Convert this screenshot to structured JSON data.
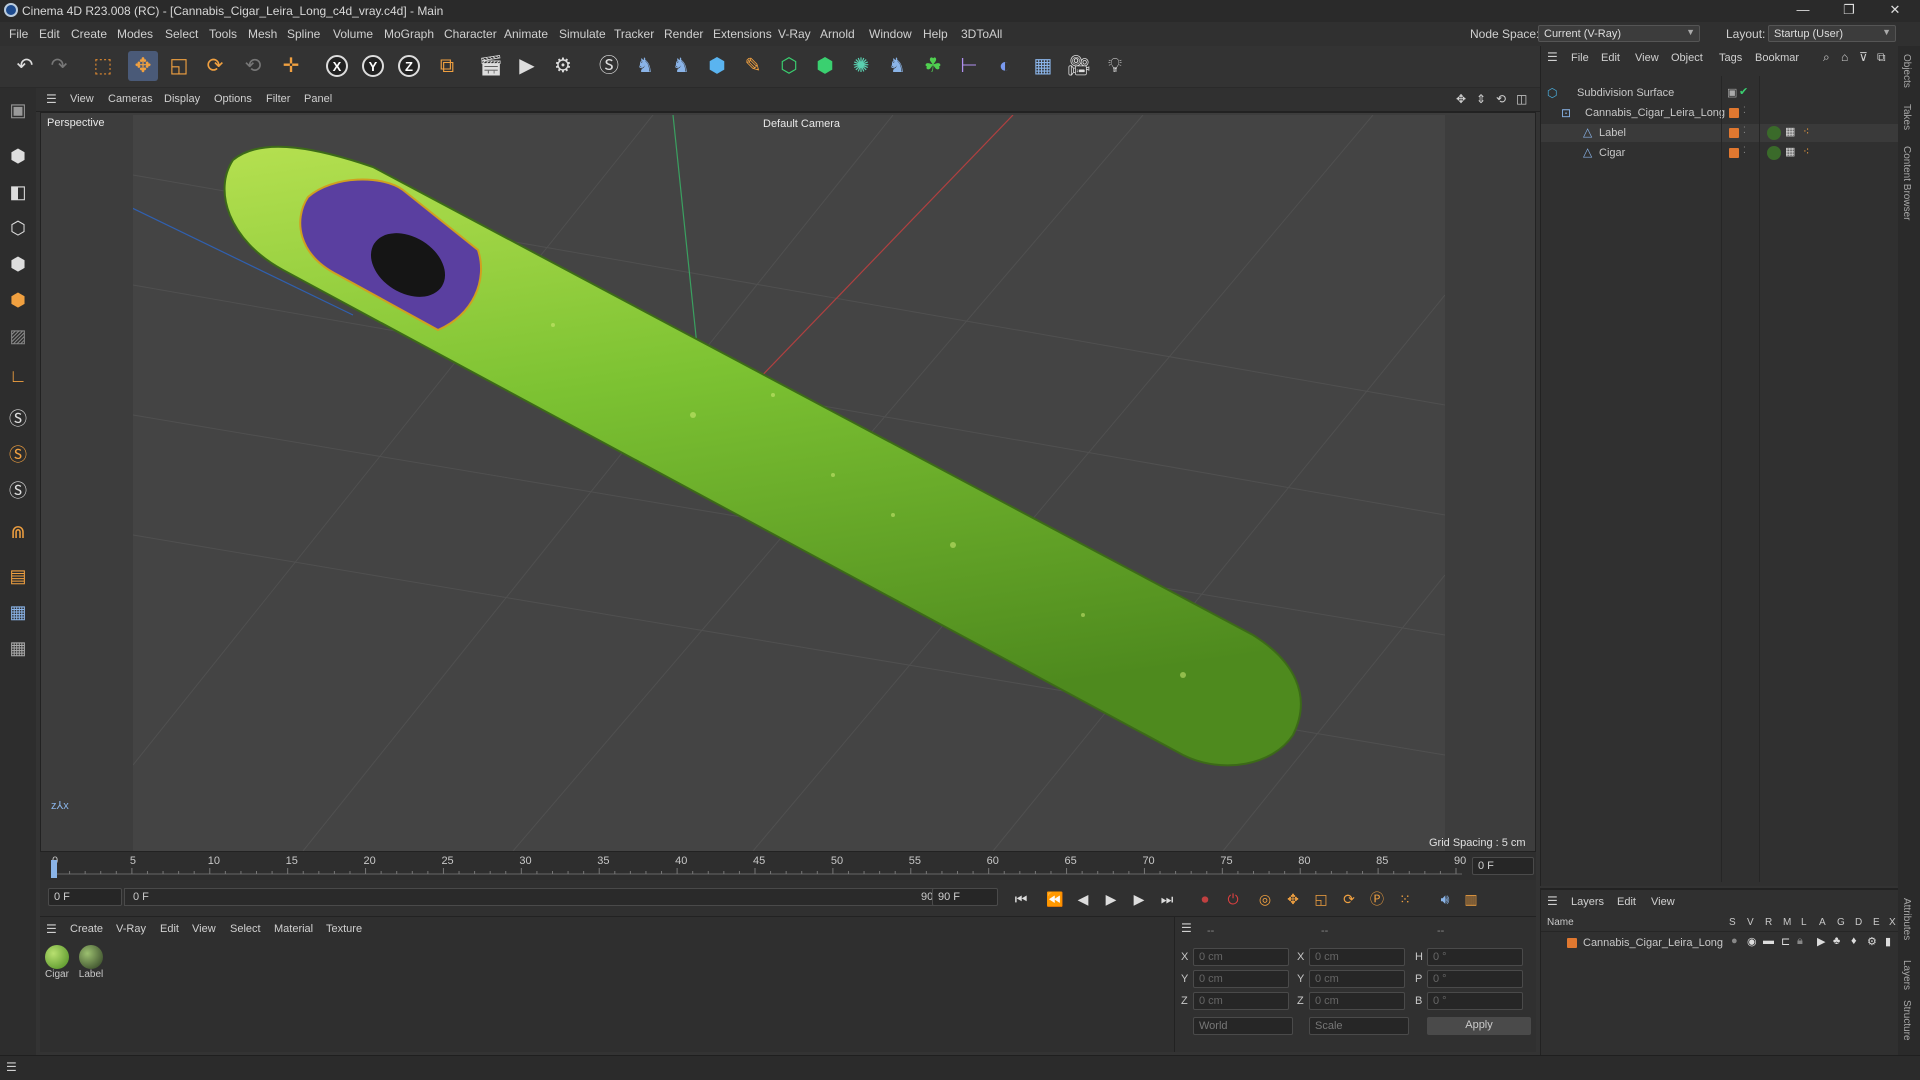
{
  "window": {
    "title": "Cinema 4D R23.008 (RC) - [Cannabis_Cigar_Leira_Long_c4d_vray.c4d] - Main",
    "minimize": "—",
    "restore": "❐",
    "close": "✕"
  },
  "menu": {
    "items": [
      "File",
      "Edit",
      "Create",
      "Modes",
      "Select",
      "Tools",
      "Mesh",
      "Spline",
      "Volume",
      "MoGraph",
      "Character",
      "Animate",
      "Simulate",
      "Tracker",
      "Render",
      "Extensions",
      "V-Ray",
      "Arnold",
      "Window",
      "Help",
      "3DToAll"
    ],
    "node_space_label": "Node Space:",
    "node_space_value": "Current (V-Ray)",
    "layout_label": "Layout:",
    "layout_value": "Startup (User)"
  },
  "viewport": {
    "menu": [
      "View",
      "Cameras",
      "Display",
      "Options",
      "Filter",
      "Panel"
    ],
    "view_name": "Perspective",
    "camera": "Default Camera",
    "grid_spacing": "Grid Spacing : 5 cm"
  },
  "timeline": {
    "ticks": [
      "0",
      "5",
      "10",
      "15",
      "20",
      "25",
      "30",
      "35",
      "40",
      "45",
      "50",
      "55",
      "60",
      "65",
      "70",
      "75",
      "80",
      "85",
      "90"
    ],
    "current_frame_field": "0 F",
    "start_field": "0 F",
    "range_start": "0 F",
    "range_end": "90 F",
    "end_field": "90 F"
  },
  "material_manager": {
    "menu": [
      "Create",
      "V-Ray",
      "Edit",
      "View",
      "Select",
      "Material",
      "Texture"
    ],
    "materials": [
      "Cigar",
      "Label"
    ]
  },
  "coordinates": {
    "header": [
      "--",
      "--",
      "--"
    ],
    "rows": [
      {
        "a": "X",
        "av": "0 cm",
        "b": "X",
        "bv": "0 cm",
        "c": "H",
        "cv": "0 °"
      },
      {
        "a": "Y",
        "av": "0 cm",
        "b": "Y",
        "bv": "0 cm",
        "c": "P",
        "cv": "0 °"
      },
      {
        "a": "Z",
        "av": "0 cm",
        "b": "Z",
        "bv": "0 cm",
        "c": "B",
        "cv": "0 °"
      }
    ],
    "mode1": "World",
    "mode2": "Scale",
    "apply": "Apply"
  },
  "object_manager": {
    "menu": [
      "File",
      "Edit",
      "View",
      "Object",
      "Tags",
      "Bookmar"
    ],
    "objects": [
      {
        "name": "Subdivision Surface",
        "level": 0
      },
      {
        "name": "Cannabis_Cigar_Leira_Long",
        "level": 1
      },
      {
        "name": "Label",
        "level": 2
      },
      {
        "name": "Cigar",
        "level": 2
      }
    ]
  },
  "layer_manager": {
    "menu": [
      "Layers",
      "Edit",
      "View"
    ],
    "col_name": "Name",
    "col_flags": [
      "S",
      "V",
      "R",
      "M",
      "L",
      "A",
      "G",
      "D",
      "E",
      "X"
    ],
    "layers": [
      "Cannabis_Cigar_Leira_Long"
    ]
  },
  "side_tabs": [
    "Objects",
    "Takes",
    "Content Browser",
    "Attributes",
    "Layers",
    "Structure"
  ],
  "colors": {
    "accent": "#4a5a78",
    "cigar_green": "#8bc33a",
    "label_purple": "#5a3fa0",
    "layer_orange": "#e07830"
  }
}
